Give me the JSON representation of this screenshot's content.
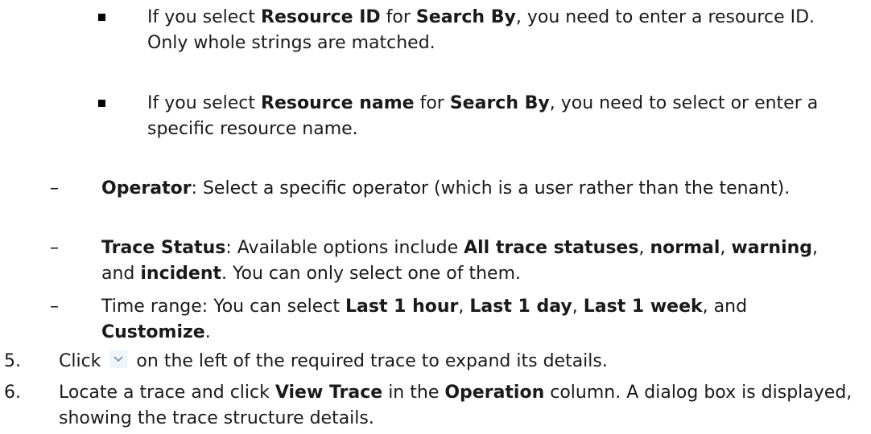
{
  "bullets_sq": [
    {
      "segments": [
        {
          "t": "If you select ",
          "b": false
        },
        {
          "t": "Resource ID",
          "b": true
        },
        {
          "t": " for ",
          "b": false
        },
        {
          "t": "Search By",
          "b": true
        },
        {
          "t": ", you need to enter a resource ID. Only whole strings are matched.",
          "b": false
        }
      ]
    },
    {
      "segments": [
        {
          "t": "If you select ",
          "b": false
        },
        {
          "t": "Resource name",
          "b": true
        },
        {
          "t": " for ",
          "b": false
        },
        {
          "t": "Search By",
          "b": true
        },
        {
          "t": ", you need to select or enter a specific resource name.",
          "b": false
        }
      ]
    }
  ],
  "dash_marker": "–",
  "bullets_dash": [
    {
      "segments": [
        {
          "t": "Operator",
          "b": true
        },
        {
          "t": ": Select a specific operator (which is a user rather than the tenant).",
          "b": false
        }
      ]
    },
    {
      "segments": [
        {
          "t": "Trace Status",
          "b": true
        },
        {
          "t": ": Available options include ",
          "b": false
        },
        {
          "t": "All trace statuses",
          "b": true
        },
        {
          "t": ", ",
          "b": false
        },
        {
          "t": "normal",
          "b": true
        },
        {
          "t": ", ",
          "b": false
        },
        {
          "t": "warning",
          "b": true
        },
        {
          "t": ", and ",
          "b": false
        },
        {
          "t": "incident",
          "b": true
        },
        {
          "t": ". You can only select one of them.",
          "b": false
        }
      ]
    },
    {
      "segments": [
        {
          "t": "Time range: You can select ",
          "b": false
        },
        {
          "t": "Last 1 hour",
          "b": true
        },
        {
          "t": ", ",
          "b": false
        },
        {
          "t": "Last 1 day",
          "b": true
        },
        {
          "t": ", ",
          "b": false
        },
        {
          "t": "Last 1 week",
          "b": true
        },
        {
          "t": ", and ",
          "b": false
        },
        {
          "t": "Customize",
          "b": true
        },
        {
          "t": ".",
          "b": false
        }
      ]
    }
  ],
  "steps": [
    {
      "num": "5.",
      "before": "Click",
      "icon": "chevron-down-icon",
      "after": "on the left of the required trace to expand its details."
    },
    {
      "num": "6.",
      "segments": [
        {
          "t": "Locate a trace and click ",
          "b": false
        },
        {
          "t": "View Trace",
          "b": true
        },
        {
          "t": " in the ",
          "b": false
        },
        {
          "t": "Operation",
          "b": true
        },
        {
          "t": " column. A dialog box is displayed, showing the trace structure details.",
          "b": false
        }
      ]
    }
  ],
  "colors": {
    "text": "#1a1a1a",
    "icon_bg": "#eef5fb",
    "icon_stroke": "#7a8ea3"
  }
}
